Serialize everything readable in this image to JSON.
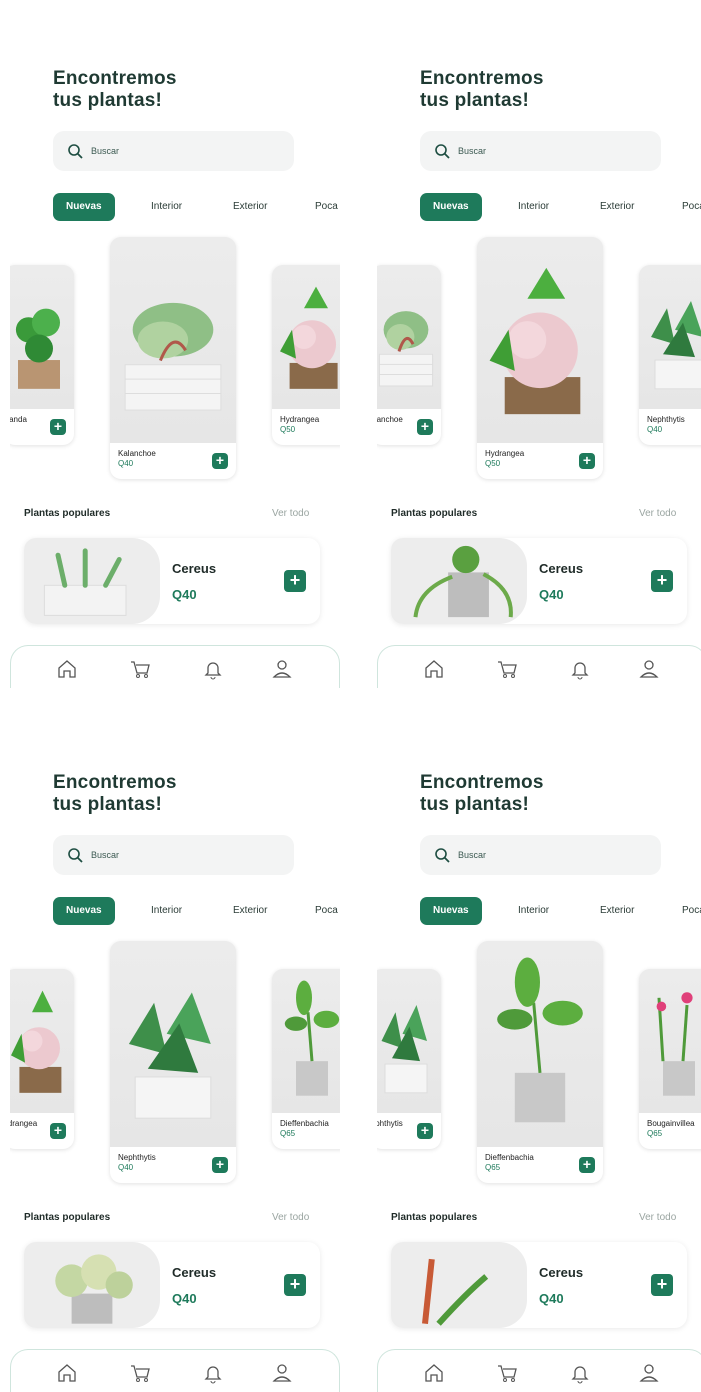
{
  "theme": {
    "accent": "#1e7a5b",
    "tab_text": "#2b3c37",
    "muted": "#9aa5a1"
  },
  "screens": [
    {
      "title_line1": "Encontremos",
      "title_line2": "tus plantas!",
      "search_placeholder": "Buscar",
      "tabs": [
        "Nuevas",
        "Interior",
        "Exterior",
        "Poca"
      ],
      "carousel": {
        "prev": {
          "name": "Miranda"
        },
        "current": {
          "name": "Kalanchoe",
          "price": "Q40"
        },
        "next": {
          "name": "Hydrangea",
          "price": "Q50"
        }
      },
      "popular_title": "Plantas populares",
      "see_all": "Ver todo",
      "popular": {
        "name": "Cereus",
        "price": "Q40"
      }
    },
    {
      "title_line1": "Encontremos",
      "title_line2": "tus plantas!",
      "search_placeholder": "Buscar",
      "tabs": [
        "Nuevas",
        "Interior",
        "Exterior",
        "Poca"
      ],
      "carousel": {
        "prev": {
          "name": "Kalanchoe"
        },
        "current": {
          "name": "Hydrangea",
          "price": "Q50"
        },
        "next": {
          "name": "Nephthytis",
          "price": "Q40"
        }
      },
      "popular_title": "Plantas populares",
      "see_all": "Ver todo",
      "popular": {
        "name": "Cereus",
        "price": "Q40"
      }
    },
    {
      "title_line1": "Encontremos",
      "title_line2": "tus plantas!",
      "search_placeholder": "Buscar",
      "tabs": [
        "Nuevas",
        "Interior",
        "Exterior",
        "Poca"
      ],
      "carousel": {
        "prev": {
          "name": "Hydrangea"
        },
        "current": {
          "name": "Nephthytis",
          "price": "Q40"
        },
        "next": {
          "name": "Dieffenbachia",
          "price": "Q65"
        }
      },
      "popular_title": "Plantas populares",
      "see_all": "Ver todo",
      "popular": {
        "name": "Cereus",
        "price": "Q40"
      }
    },
    {
      "title_line1": "Encontremos",
      "title_line2": "tus plantas!",
      "search_placeholder": "Buscar",
      "tabs": [
        "Nuevas",
        "Interior",
        "Exterior",
        "Poca"
      ],
      "carousel": {
        "prev": {
          "name": "Nephthytis"
        },
        "current": {
          "name": "Dieffenbachia",
          "price": "Q65"
        },
        "next": {
          "name": "Bougainvillea",
          "price": "Q65"
        }
      },
      "popular_title": "Plantas populares",
      "see_all": "Ver todo",
      "popular": {
        "name": "Cereus",
        "price": "Q40"
      }
    }
  ],
  "bottom_nav": [
    "home-icon",
    "cart-icon",
    "bell-icon",
    "user-icon"
  ]
}
